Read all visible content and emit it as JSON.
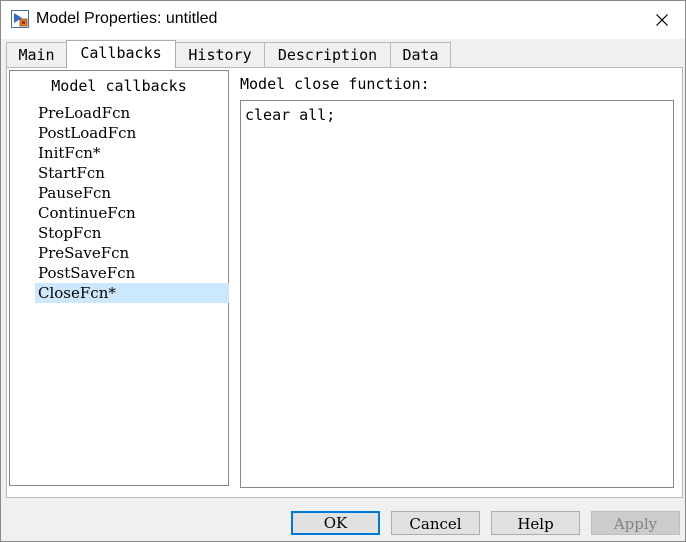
{
  "window": {
    "title": "Model Properties: untitled",
    "icon": "simulink-model-icon",
    "close_icon": "close-icon"
  },
  "tabs": [
    {
      "label": "Main",
      "active": false
    },
    {
      "label": "Callbacks",
      "active": true
    },
    {
      "label": "History",
      "active": false
    },
    {
      "label": "Description",
      "active": false
    },
    {
      "label": "Data",
      "active": false
    }
  ],
  "callbacks": {
    "header": "Model callbacks",
    "items": [
      {
        "label": "PreLoadFcn"
      },
      {
        "label": "PostLoadFcn"
      },
      {
        "label": "InitFcn*"
      },
      {
        "label": "StartFcn"
      },
      {
        "label": "PauseFcn"
      },
      {
        "label": "ContinueFcn"
      },
      {
        "label": "StopFcn"
      },
      {
        "label": "PreSaveFcn"
      },
      {
        "label": "PostSaveFcn"
      },
      {
        "label": "CloseFcn*"
      }
    ],
    "selected": "CloseFcn*"
  },
  "editor": {
    "label": "Model close function:",
    "value": "clear all;"
  },
  "buttons": {
    "ok": "OK",
    "cancel": "Cancel",
    "help": "Help",
    "apply": "Apply"
  },
  "colors": {
    "selection": "#cce8ff",
    "default_button_border": "#0078d7"
  }
}
